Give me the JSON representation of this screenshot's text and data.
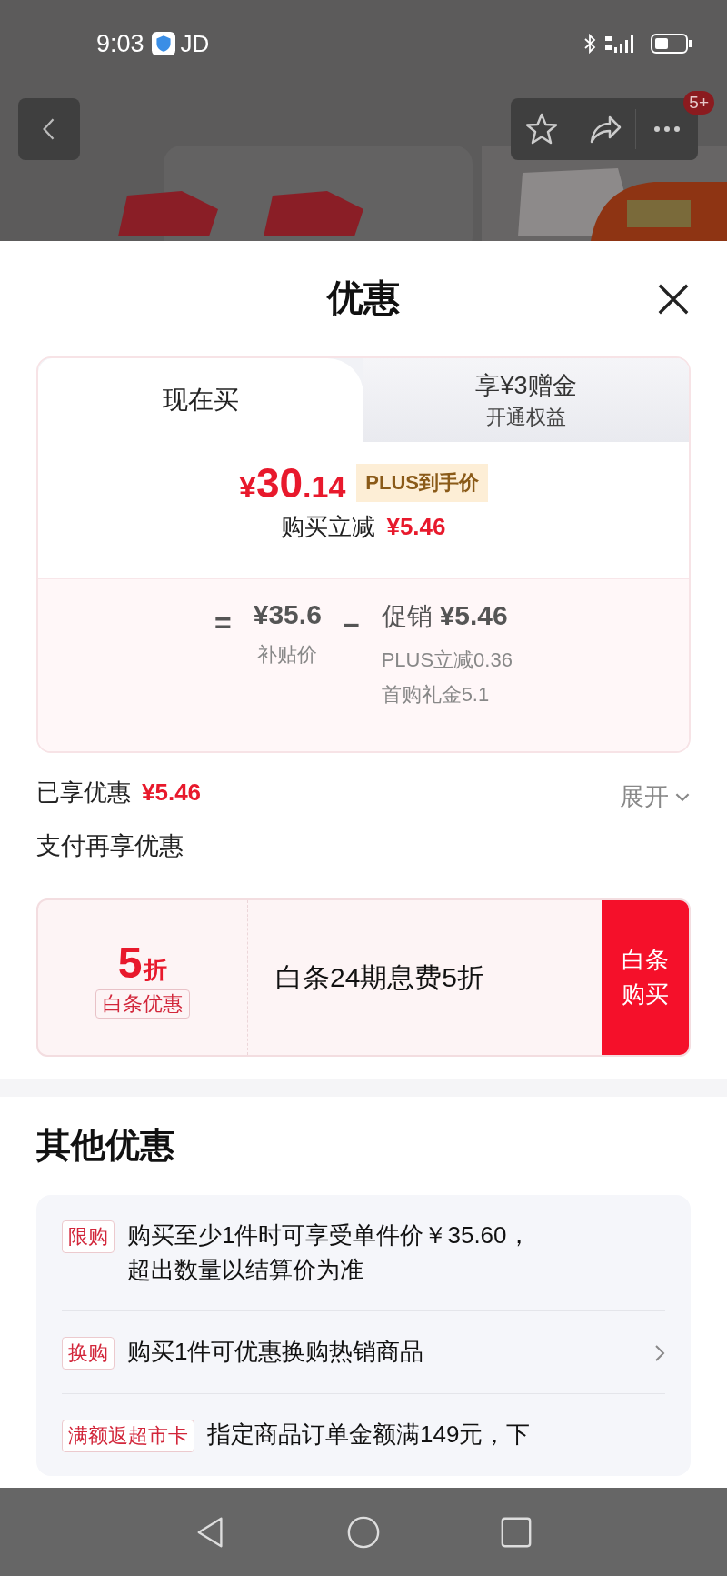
{
  "status_bar": {
    "time": "9:03",
    "app": "JD"
  },
  "header": {
    "badge": "5+"
  },
  "sheet": {
    "title": "优惠"
  },
  "tabs": [
    {
      "label": "现在买",
      "selected": true
    },
    {
      "label": "享¥3赠金",
      "sublabel": "开通权益",
      "selected": false
    }
  ],
  "price": {
    "currency": "¥",
    "integer": "30",
    "decimal": ".14",
    "badge": "PLUS到手价",
    "reduction_label": "购买立减",
    "reduction": "¥5.46"
  },
  "formula": {
    "equals": "=",
    "base_price": "¥35.6",
    "base_label": "补贴价",
    "minus": "–",
    "promo_label": "促销",
    "promo_amount": "¥5.46",
    "promo_details": [
      "PLUS立减0.36",
      "首购礼金5.1"
    ]
  },
  "enjoyed": {
    "label": "已享优惠",
    "amount": "¥5.46",
    "expand": "展开"
  },
  "pay_section": {
    "title": "支付再享优惠",
    "discount": "5",
    "discount_unit": "折",
    "tag": "白条优惠",
    "description": "白条24期息费5折",
    "button": "白条购买"
  },
  "other": {
    "title": "其他优惠",
    "items": [
      {
        "tag": "限购",
        "text": "购买至少1件时可享受单件价￥35.60，超出数量以结算价为准",
        "has_link": false
      },
      {
        "tag": "换购",
        "text": "购买1件可优惠换购热销商品",
        "has_link": true
      },
      {
        "tag": "满额返超市卡",
        "text": "指定商品订单金额满149元，下",
        "has_link": false
      }
    ]
  }
}
